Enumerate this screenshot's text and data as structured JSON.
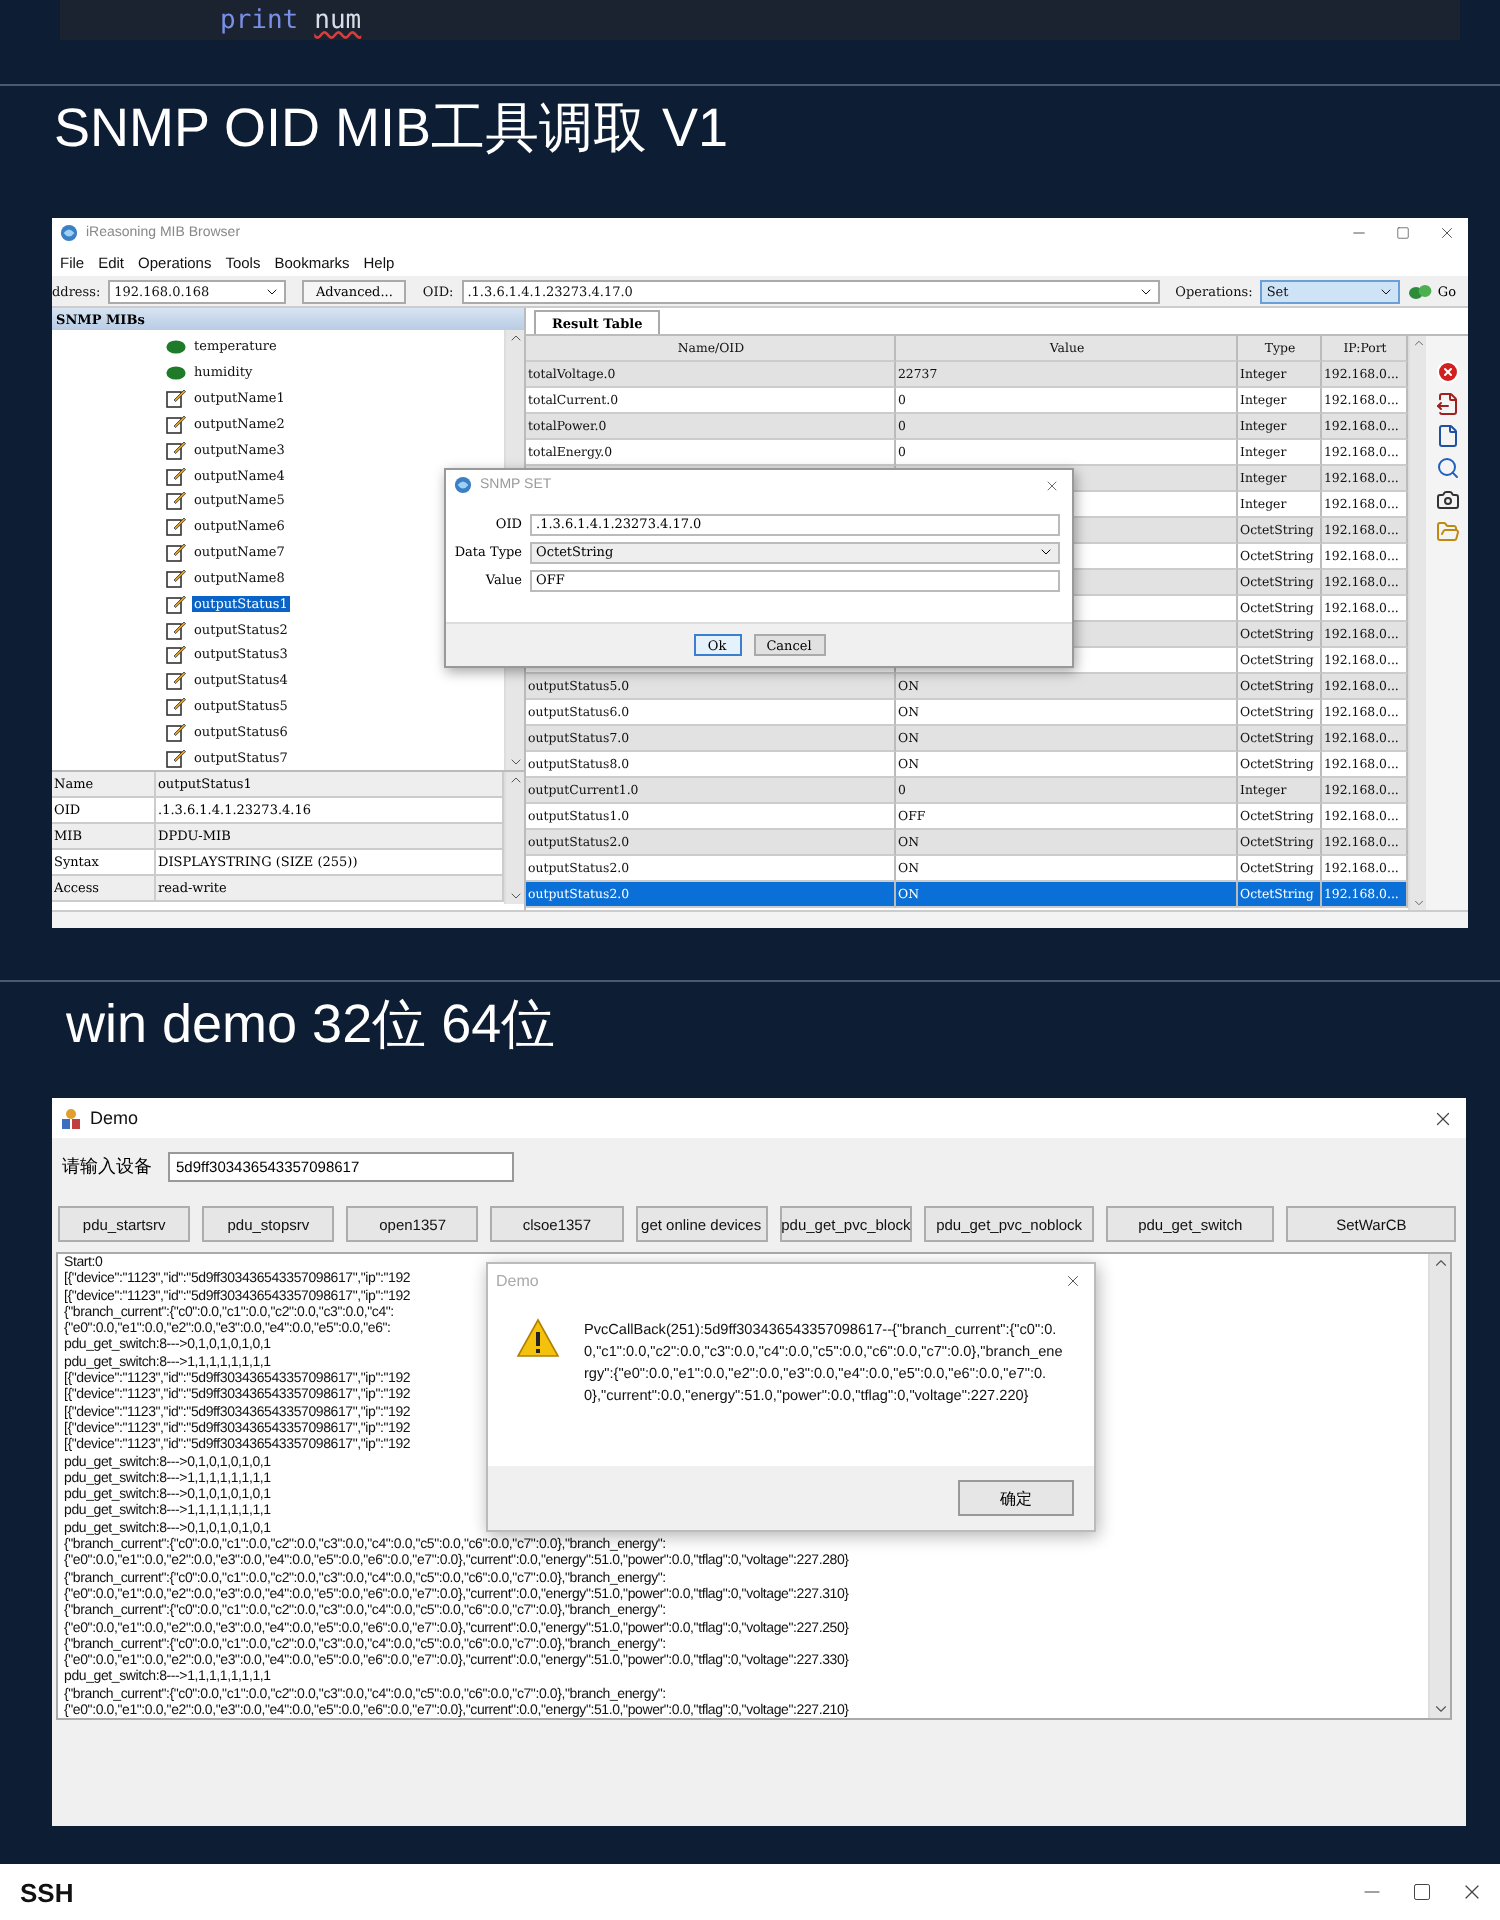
{
  "code_line": {
    "keyword": "print",
    "identifier": "num"
  },
  "mib": {
    "heading": "SNMP OID MIB工具调取 V1",
    "window": {
      "title": "iReasoning MIB Browser",
      "menu": [
        "File",
        "Edit",
        "Operations",
        "Tools",
        "Bookmarks",
        "Help"
      ],
      "toolbar": {
        "address_label": "ddress:",
        "address": "192.168.0.168",
        "advanced": "Advanced...",
        "oid_label": "OID:",
        "oid": ".1.3.6.1.4.1.23273.4.17.0",
        "operations_label": "Operations:",
        "operation": "Set",
        "go": "Go"
      },
      "tree_header": "SNMP MIBs",
      "tree": [
        {
          "label": "temperature",
          "kind": "object",
          "selected": false
        },
        {
          "label": "humidity",
          "kind": "object",
          "selected": false
        },
        {
          "label": "outputName1",
          "kind": "editable",
          "selected": false
        },
        {
          "label": "outputName2",
          "kind": "editable",
          "selected": false
        },
        {
          "label": "outputName3",
          "kind": "editable",
          "selected": false
        },
        {
          "label": "outputName4",
          "kind": "editable",
          "selected": false
        },
        {
          "label": "outputName5",
          "kind": "editable",
          "selected": false
        },
        {
          "label": "outputName6",
          "kind": "editable",
          "selected": false
        },
        {
          "label": "outputName7",
          "kind": "editable",
          "selected": false
        },
        {
          "label": "outputName8",
          "kind": "editable",
          "selected": false
        },
        {
          "label": "outputStatus1",
          "kind": "editable",
          "selected": true
        },
        {
          "label": "outputStatus2",
          "kind": "editable",
          "selected": false
        },
        {
          "label": "outputStatus3",
          "kind": "editable",
          "selected": false
        },
        {
          "label": "outputStatus4",
          "kind": "editable",
          "selected": false
        },
        {
          "label": "outputStatus5",
          "kind": "editable",
          "selected": false
        },
        {
          "label": "outputStatus6",
          "kind": "editable",
          "selected": false
        },
        {
          "label": "outputStatus7",
          "kind": "editable",
          "selected": false
        }
      ],
      "properties": [
        {
          "name": "Name",
          "value": "outputStatus1"
        },
        {
          "name": "OID",
          "value": ".1.3.6.1.4.1.23273.4.16"
        },
        {
          "name": "MIB",
          "value": "DPDU-MIB"
        },
        {
          "name": "Syntax",
          "value": "DISPLAYSTRING (SIZE (255))"
        },
        {
          "name": "Access",
          "value": "read-write"
        }
      ],
      "result_tab": "Result Table",
      "columns": [
        "Name/OID",
        "Value",
        "Type",
        "IP:Port"
      ],
      "rows": [
        {
          "name": "totalVoltage.0",
          "value": "22737",
          "type": "Integer",
          "ip_port": "192.168.0...",
          "selected": false
        },
        {
          "name": "totalCurrent.0",
          "value": "0",
          "type": "Integer",
          "ip_port": "192.168.0...",
          "selected": false
        },
        {
          "name": "totalPower.0",
          "value": "0",
          "type": "Integer",
          "ip_port": "192.168.0...",
          "selected": false
        },
        {
          "name": "totalEnergy.0",
          "value": "0",
          "type": "Integer",
          "ip_port": "192.168.0...",
          "selected": false
        },
        {
          "type": "Integer",
          "ip_port": "192.168.0...",
          "selected": false
        },
        {
          "type": "Integer",
          "ip_port": "192.168.0...",
          "selected": false
        },
        {
          "type": "OctetString",
          "ip_port": "192.168.0...",
          "selected": false
        },
        {
          "type": "OctetString",
          "ip_port": "192.168.0...",
          "selected": false
        },
        {
          "type": "OctetString",
          "ip_port": "192.168.0...",
          "selected": false
        },
        {
          "type": "OctetString",
          "ip_port": "192.168.0...",
          "selected": false
        },
        {
          "type": "OctetString",
          "ip_port": "192.168.0...",
          "selected": false
        },
        {
          "type": "OctetString",
          "ip_port": "192.168.0...",
          "selected": false
        },
        {
          "name": "outputStatus5.0",
          "value": "ON",
          "type": "OctetString",
          "ip_port": "192.168.0...",
          "selected": false
        },
        {
          "name": "outputStatus6.0",
          "value": "ON",
          "type": "OctetString",
          "ip_port": "192.168.0...",
          "selected": false
        },
        {
          "name": "outputStatus7.0",
          "value": "ON",
          "type": "OctetString",
          "ip_port": "192.168.0...",
          "selected": false
        },
        {
          "name": "outputStatus8.0",
          "value": "ON",
          "type": "OctetString",
          "ip_port": "192.168.0...",
          "selected": false
        },
        {
          "name": "outputCurrent1.0",
          "value": "0",
          "type": "Integer",
          "ip_port": "192.168.0...",
          "selected": false
        },
        {
          "name": "outputStatus1.0",
          "value": "OFF",
          "type": "OctetString",
          "ip_port": "192.168.0...",
          "selected": false
        },
        {
          "name": "outputStatus2.0",
          "value": "ON",
          "type": "OctetString",
          "ip_port": "192.168.0...",
          "selected": false
        },
        {
          "name": "outputStatus2.0",
          "value": "ON",
          "type": "OctetString",
          "ip_port": "192.168.0...",
          "selected": false
        },
        {
          "name": "outputStatus2.0",
          "value": "ON",
          "type": "OctetString",
          "ip_port": "192.168.0...",
          "selected": true
        }
      ],
      "set_dialog": {
        "title": "SNMP SET",
        "fields": [
          {
            "label": "OID",
            "value": ".1.3.6.1.4.1.23273.4.17.0",
            "kind": "text"
          },
          {
            "label": "Data Type",
            "value": "OctetString",
            "kind": "select"
          },
          {
            "label": "Value",
            "value": "OFF",
            "kind": "text"
          }
        ],
        "buttons": [
          "Ok",
          "Cancel"
        ]
      }
    }
  },
  "demo": {
    "heading": "win demo 32位 64位",
    "window": {
      "title": "Demo",
      "device_label": "请输入设备",
      "device_id": "5d9ff303436543357098617",
      "buttons": [
        "pdu_startsrv",
        "pdu_stopsrv",
        "open1357",
        "clsoe1357",
        "get online devices",
        "pdu_get_pvc_block",
        "pdu_get_pvc_noblock",
        "pdu_get_switch",
        "SetWarCB"
      ],
      "log": [
        "Start:0",
        "[{\"device\":\"1123\",\"id\":\"5d9ff303436543357098617\",\"ip\":\"192",
        "[{\"device\":\"1123\",\"id\":\"5d9ff303436543357098617\",\"ip\":\"192",
        "{\"branch_current\":{\"c0\":0.0,\"c1\":0.0,\"c2\":0.0,\"c3\":0.0,\"c4\":",
        "{\"e0\":0.0,\"e1\":0.0,\"e2\":0.0,\"e3\":0.0,\"e4\":0.0,\"e5\":0.0,\"e6\":",
        "pdu_get_switch:8--->0,1,0,1,0,1,0,1",
        "pdu_get_switch:8--->1,1,1,1,1,1,1,1",
        "[{\"device\":\"1123\",\"id\":\"5d9ff303436543357098617\",\"ip\":\"192",
        "[{\"device\":\"1123\",\"id\":\"5d9ff303436543357098617\",\"ip\":\"192",
        "[{\"device\":\"1123\",\"id\":\"5d9ff303436543357098617\",\"ip\":\"192",
        "[{\"device\":\"1123\",\"id\":\"5d9ff303436543357098617\",\"ip\":\"192",
        "[{\"device\":\"1123\",\"id\":\"5d9ff303436543357098617\",\"ip\":\"192",
        "pdu_get_switch:8--->0,1,0,1,0,1,0,1",
        "pdu_get_switch:8--->1,1,1,1,1,1,1,1",
        "pdu_get_switch:8--->0,1,0,1,0,1,0,1",
        "pdu_get_switch:8--->1,1,1,1,1,1,1,1",
        "pdu_get_switch:8--->0,1,0,1,0,1,0,1",
        "{\"branch_current\":{\"c0\":0.0,\"c1\":0.0,\"c2\":0.0,\"c3\":0.0,\"c4\":0.0,\"c5\":0.0,\"c6\":0.0,\"c7\":0.0},\"branch_energy\":",
        "{\"e0\":0.0,\"e1\":0.0,\"e2\":0.0,\"e3\":0.0,\"e4\":0.0,\"e5\":0.0,\"e6\":0.0,\"e7\":0.0},\"current\":0.0,\"energy\":51.0,\"power\":0.0,\"tflag\":0,\"voltage\":227.280}",
        "{\"branch_current\":{\"c0\":0.0,\"c1\":0.0,\"c2\":0.0,\"c3\":0.0,\"c4\":0.0,\"c5\":0.0,\"c6\":0.0,\"c7\":0.0},\"branch_energy\":",
        "{\"e0\":0.0,\"e1\":0.0,\"e2\":0.0,\"e3\":0.0,\"e4\":0.0,\"e5\":0.0,\"e6\":0.0,\"e7\":0.0},\"current\":0.0,\"energy\":51.0,\"power\":0.0,\"tflag\":0,\"voltage\":227.310}",
        "{\"branch_current\":{\"c0\":0.0,\"c1\":0.0,\"c2\":0.0,\"c3\":0.0,\"c4\":0.0,\"c5\":0.0,\"c6\":0.0,\"c7\":0.0},\"branch_energy\":",
        "{\"e0\":0.0,\"e1\":0.0,\"e2\":0.0,\"e3\":0.0,\"e4\":0.0,\"e5\":0.0,\"e6\":0.0,\"e7\":0.0},\"current\":0.0,\"energy\":51.0,\"power\":0.0,\"tflag\":0,\"voltage\":227.250}",
        "{\"branch_current\":{\"c0\":0.0,\"c1\":0.0,\"c2\":0.0,\"c3\":0.0,\"c4\":0.0,\"c5\":0.0,\"c6\":0.0,\"c7\":0.0},\"branch_energy\":",
        "{\"e0\":0.0,\"e1\":0.0,\"e2\":0.0,\"e3\":0.0,\"e4\":0.0,\"e5\":0.0,\"e6\":0.0,\"e7\":0.0},\"current\":0.0,\"energy\":51.0,\"power\":0.0,\"tflag\":0,\"voltage\":227.330}",
        "pdu_get_switch:8--->1,1,1,1,1,1,1,1",
        "{\"branch_current\":{\"c0\":0.0,\"c1\":0.0,\"c2\":0.0,\"c3\":0.0,\"c4\":0.0,\"c5\":0.0,\"c6\":0.0,\"c7\":0.0},\"branch_energy\":",
        "{\"e0\":0.0,\"e1\":0.0,\"e2\":0.0,\"e3\":0.0,\"e4\":0.0,\"e5\":0.0,\"e6\":0.0,\"e7\":0.0},\"current\":0.0,\"energy\":51.0,\"power\":0.0,\"tflag\":0,\"voltage\":227.210}"
      ],
      "dialog": {
        "title": "Demo",
        "message": "PvcCallBack(251):5d9ff303436543357098617--{\"branch_current\":{\"c0\":0.0,\"c1\":0.0,\"c2\":0.0,\"c3\":0.0,\"c4\":0.0,\"c5\":0.0,\"c6\":0.0,\"c7\":0.0},\"branch_energy\":{\"e0\":0.0,\"e1\":0.0,\"e2\":0.0,\"e3\":0.0,\"e4\":0.0,\"e5\":0.0,\"e6\":0.0,\"e7\":0.0},\"current\":0.0,\"energy\":51.0,\"power\":0.0,\"tflag\":0,\"voltage\":227.220}",
        "button": "确定"
      }
    }
  },
  "ssh_window": {
    "title": "SSH"
  }
}
